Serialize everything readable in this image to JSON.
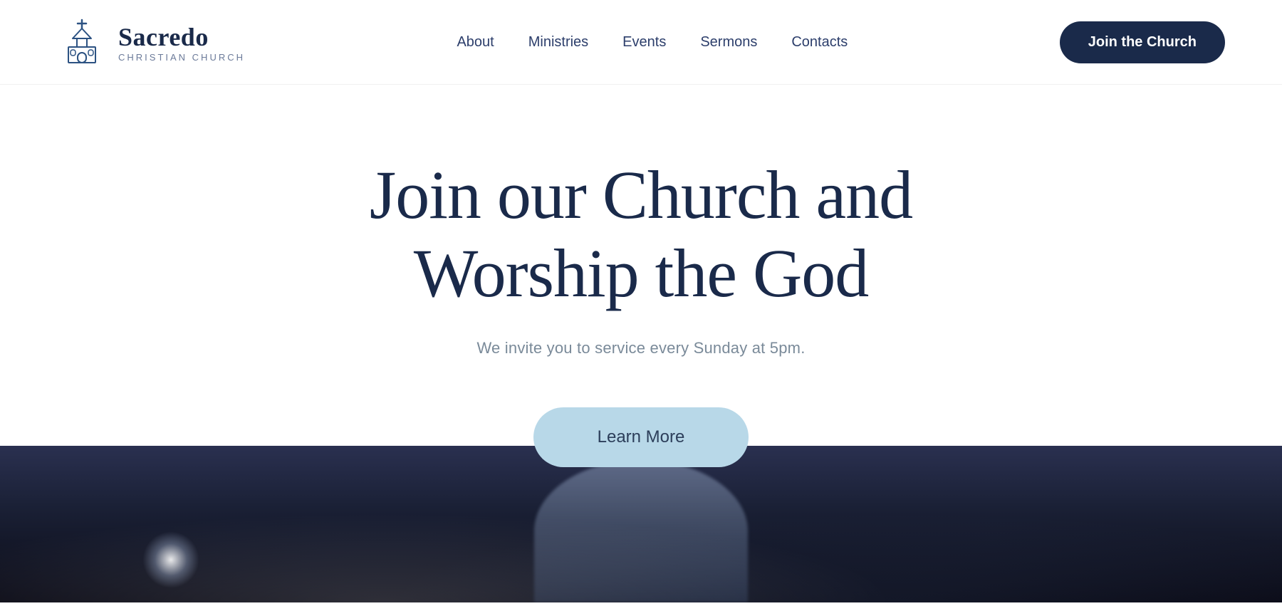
{
  "header": {
    "logo": {
      "name": "Sacredo",
      "subtitle": "CHRISTIAN CHURCH"
    },
    "nav": {
      "items": [
        {
          "label": "About",
          "href": "#"
        },
        {
          "label": "Ministries",
          "href": "#"
        },
        {
          "label": "Events",
          "href": "#"
        },
        {
          "label": "Sermons",
          "href": "#"
        },
        {
          "label": "Contacts",
          "href": "#"
        }
      ],
      "cta_label": "Join the Church"
    }
  },
  "hero": {
    "title_line1": "Join our Church and",
    "title_line2": "Worship the God",
    "subtitle": "We invite you to service every Sunday at 5pm.",
    "cta_label": "Learn More"
  },
  "colors": {
    "brand_dark": "#1a2a4a",
    "brand_light": "#b8d8e8",
    "text_muted": "#7a8a99",
    "nav_link": "#2c3e6b"
  }
}
